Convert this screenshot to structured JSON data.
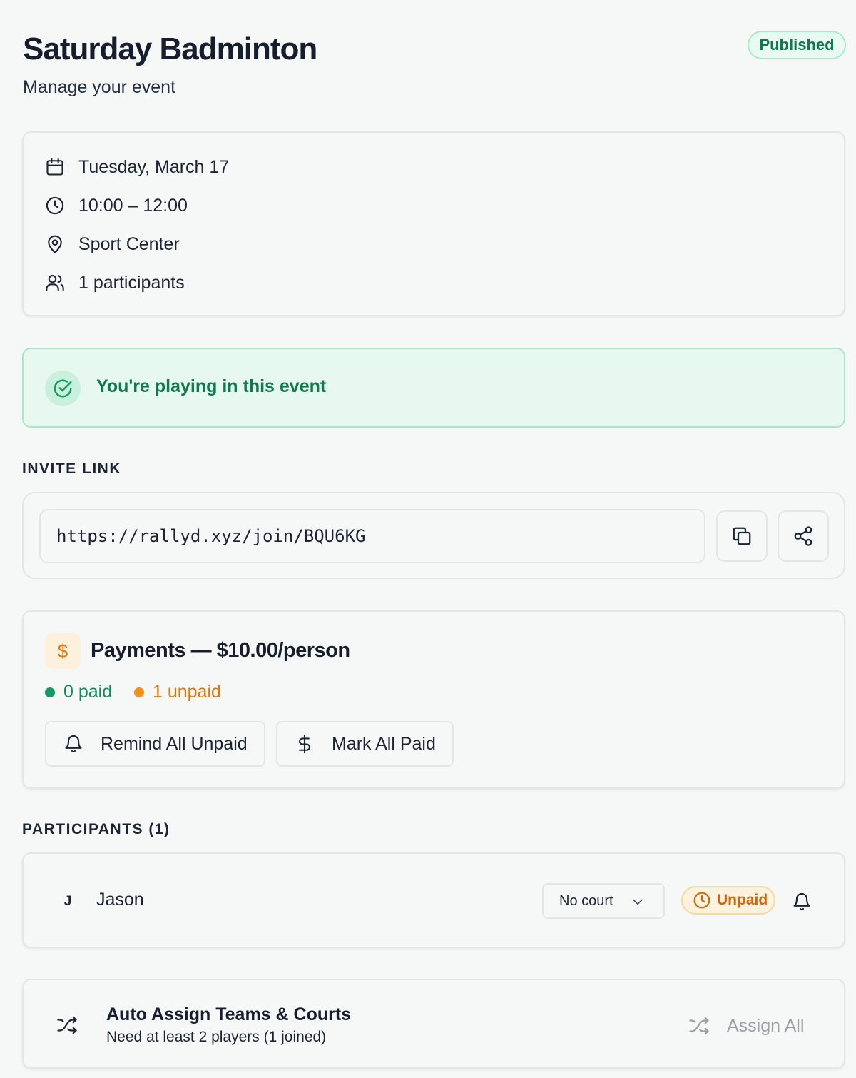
{
  "header": {
    "title": "Saturday Badminton",
    "subtitle": "Manage your event",
    "status": "Published"
  },
  "details": {
    "date": "Tuesday, March 17",
    "time": "10:00 – 12:00",
    "location": "Sport Center",
    "participants": "1 participants",
    "icons": [
      "calendar-icon",
      "clock-icon",
      "map-pin-icon",
      "users-icon"
    ]
  },
  "banner": {
    "text": "You're playing in this event",
    "icon": "check-circle-icon"
  },
  "invite": {
    "label": "INVITE LINK",
    "url": "https://rallyd.xyz/join/BQU6KG",
    "copy_icon": "copy-icon",
    "share_icon": "share-icon"
  },
  "payments": {
    "badge_symbol": "$",
    "title": "Payments — $10.00/person",
    "paid": "0 paid",
    "unpaid": "1 unpaid",
    "remind_label": "Remind All Unpaid",
    "mark_paid_label": "Mark All Paid"
  },
  "participants": {
    "label": "PARTICIPANTS (1)",
    "items": [
      {
        "initial": "J",
        "name": "Jason",
        "court": "No court",
        "status": "Unpaid"
      }
    ]
  },
  "auto_assign": {
    "title": "Auto Assign Teams & Courts",
    "subtitle": "Need at least 2 players (1 joined)",
    "button_label": "Assign All"
  },
  "colors": {
    "background": "#f5f8f6",
    "success": "#0f7a4f",
    "success_bg": "#e6f8f0",
    "warning": "#e27a0c",
    "paid_dot": "#169a63",
    "unpaid_dot": "#f0901f",
    "muted": "#9aa0a8"
  }
}
